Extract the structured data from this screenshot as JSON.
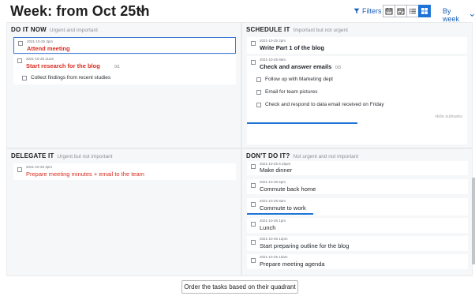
{
  "header": {
    "title": "Week: from Oct 25th",
    "filters_label": "Filters",
    "view_buttons": [
      "calendar-view-icon",
      "calendar-check-view-icon",
      "list-view-icon",
      "grid-view-icon"
    ],
    "active_view": "grid-view-icon",
    "period_label": "By week",
    "accent_color": "#1f73d6"
  },
  "quadrants": {
    "do_it_now": {
      "title": "DO IT NOW",
      "subtitle": "Urgent and important",
      "tasks": [
        {
          "date": "2021-10-25 3pm",
          "name": "Attend meeting"
        },
        {
          "date": "2021-10-25 11am",
          "name": "Start research for the blog",
          "count": "0/1",
          "subtasks": [
            "Collect findings from recent studies"
          ]
        }
      ]
    },
    "schedule_it": {
      "title": "SCHEDULE IT",
      "subtitle": "Important but not urgent",
      "tasks": [
        {
          "date": "2021-10-25 2pm",
          "name": "Write Part 1 of the blog"
        },
        {
          "date": "2021-10-25 9am",
          "name": "Check and answer emails",
          "count": "0/3",
          "subtasks": [
            "Follow up with Marketing dept",
            "Email for team pictures",
            "Check and respond to data email received on Friday"
          ],
          "hide_label": "Hide subtasks",
          "progress": 0.5
        }
      ]
    },
    "delegate_it": {
      "title": "DELEGATE IT",
      "subtitle": "Urgent but not important",
      "tasks": [
        {
          "date": "2021-10-25 4pm",
          "name": "Prepare meeting minutes + email to the team"
        }
      ]
    },
    "dont_do_it": {
      "title": "DON'T DO IT?",
      "subtitle": "Not urgent and not important",
      "tasks": [
        {
          "date": "2021-10-25 6:15pm",
          "name": "Make dinner"
        },
        {
          "date": "2021-10-25 5pm",
          "name": "Commute back home"
        },
        {
          "date": "2021-10-25 8am",
          "name": "Commute to work",
          "progress": 0.3
        },
        {
          "date": "2021-10-25 1pm",
          "name": "Lunch"
        },
        {
          "date": "2021-10-25 12pm",
          "name": "Start preparing outline for the blog"
        },
        {
          "date": "2021-10-25 10am",
          "name": "Prepare meeting agenda"
        }
      ]
    }
  },
  "footer": {
    "order_button": "Order the tasks based on their quadrant"
  }
}
